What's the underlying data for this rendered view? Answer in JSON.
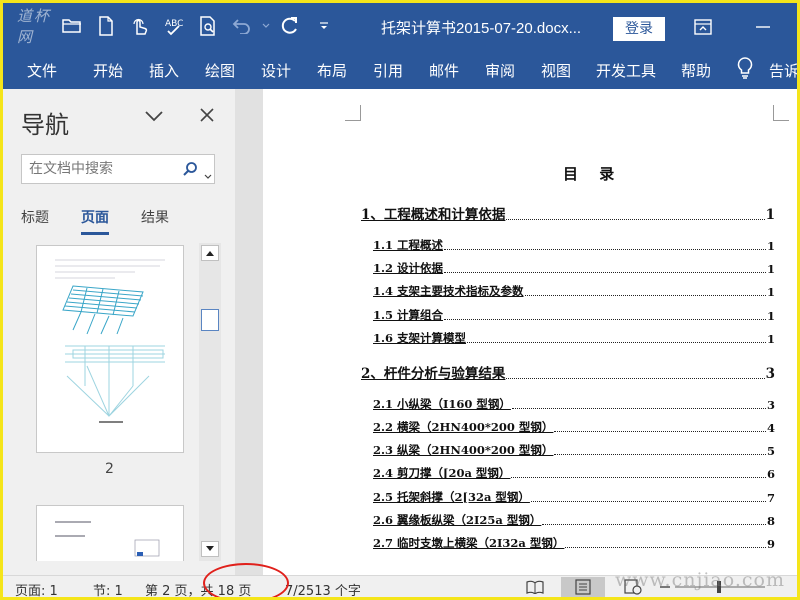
{
  "titlebar": {
    "logo_text": "道杯网",
    "doc_title": "托架计算书2015-07-20.docx...",
    "login_label": "登录"
  },
  "ribbon": {
    "tabs": [
      "文件",
      "开始",
      "插入",
      "绘图",
      "设计",
      "布局",
      "引用",
      "邮件",
      "审阅",
      "视图",
      "开发工具",
      "帮助",
      "告诉"
    ]
  },
  "nav": {
    "title": "导航",
    "search_placeholder": "在文档中搜索",
    "tabs": [
      "标题",
      "页面",
      "结果"
    ],
    "active_tab": "页面",
    "thumbnails": [
      {
        "page": "2"
      },
      {
        "page": ""
      }
    ]
  },
  "document": {
    "toc_title": "目  录",
    "entries": [
      {
        "level": 1,
        "text": "1、工程概述和计算依据",
        "page": "1"
      },
      {
        "level": 2,
        "text": "1.1 工程概述",
        "page": "1"
      },
      {
        "level": 2,
        "text": "1.2 设计依据",
        "page": "1"
      },
      {
        "level": 2,
        "text": "1.4 支架主要技术指标及参数",
        "page": "1"
      },
      {
        "level": 2,
        "text": "1.5 计算组合",
        "page": "1"
      },
      {
        "level": 2,
        "text": "1.6 支架计算模型",
        "page": "1"
      },
      {
        "level": 1,
        "text": "2、杆件分析与验算结果",
        "page": "3"
      },
      {
        "level": 2,
        "text": "2.1 小纵梁（I160 型钢）",
        "page": "3"
      },
      {
        "level": 2,
        "text": "2.2 横梁（2HN400*200 型钢）",
        "page": "4"
      },
      {
        "level": 2,
        "text": "2.3 纵梁（2HN400*200 型钢）",
        "page": "5"
      },
      {
        "level": 2,
        "text": "2.4 剪刀撑（[20a 型钢）",
        "page": "6"
      },
      {
        "level": 2,
        "text": "2.5 托架斜撑（2[32a 型钢）",
        "page": "7"
      },
      {
        "level": 2,
        "text": "2.6 翼缘板纵梁（2I25a 型钢）",
        "page": "8"
      },
      {
        "level": 2,
        "text": "2.7 临时支墩上横梁（2I32a 型钢）",
        "page": "9"
      }
    ]
  },
  "status": {
    "page": "页面: 1",
    "section": "节: 1",
    "page_of": "第 2 页，共 18 页",
    "words": "7/2513 个字",
    "watermark": "www.cnjiao.com"
  },
  "colors": {
    "accent": "#2b579a",
    "highlight_circle": "#e0201b",
    "outer_border": "#f5e51a"
  }
}
